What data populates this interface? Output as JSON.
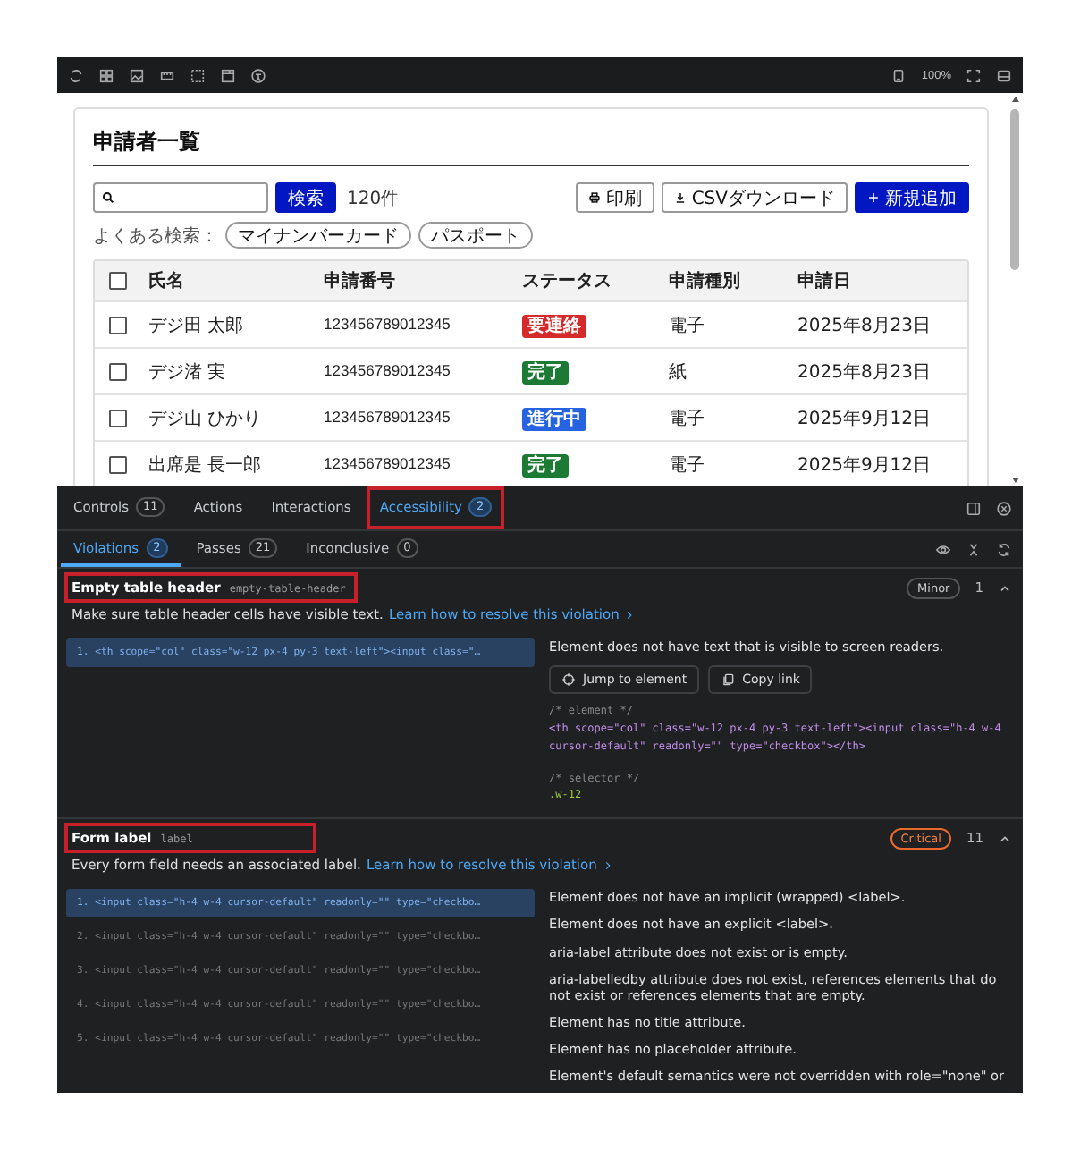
{
  "toolbar": {
    "zoom": "100%"
  },
  "page": {
    "title": "申請者一覧",
    "search_button": "検索",
    "result_count": "120件",
    "actions": [
      {
        "label": "印刷",
        "kind": "print"
      },
      {
        "label": "CSVダウンロード",
        "kind": "download"
      },
      {
        "label": "新規追加",
        "kind": "add"
      }
    ],
    "suggestions": {
      "label": "よくある検索：",
      "chips": [
        "マイナンバーカード",
        "パスポート"
      ]
    },
    "table": {
      "header_checked": false,
      "columns": [
        "氏名",
        "申請番号",
        "ステータス",
        "申請種別",
        "申請日"
      ],
      "rows": [
        {
          "checked": false,
          "name": "デジ田 太郎",
          "number": "123456789012345",
          "status": {
            "label": "要連絡",
            "color": "#d42a2a"
          },
          "type": "電子",
          "date": "2025年8月23日"
        },
        {
          "checked": false,
          "name": "デジ渚 実",
          "number": "123456789012345",
          "status": {
            "label": "完了",
            "color": "#1d7a35"
          },
          "type": "紙",
          "date": "2025年8月23日"
        },
        {
          "checked": false,
          "name": "デジ山 ひかり",
          "number": "123456789012345",
          "status": {
            "label": "進行中",
            "color": "#2563e0"
          },
          "type": "電子",
          "date": "2025年9月12日"
        },
        {
          "checked": false,
          "name": "出席是 長一郎",
          "number": "123456789012345",
          "status": {
            "label": "完了",
            "color": "#1d7a35"
          },
          "type": "電子",
          "date": "2025年9月12日"
        }
      ]
    }
  },
  "panel": {
    "tabs": [
      {
        "label": "Controls",
        "count": "11",
        "selected": false,
        "annotated": false
      },
      {
        "label": "Actions",
        "selected": false,
        "annotated": false
      },
      {
        "label": "Interactions",
        "selected": false,
        "annotated": false
      },
      {
        "label": "Accessibility",
        "count": "2",
        "selected": true,
        "annotated": true
      }
    ],
    "subtabs": [
      {
        "label": "Violations",
        "count": "2",
        "selected": true
      },
      {
        "label": "Passes",
        "count": "21",
        "selected": false
      },
      {
        "label": "Inconclusive",
        "count": "0",
        "selected": false
      }
    ],
    "violations": [
      {
        "title": "Empty table header",
        "id": "empty-table-header",
        "annotated": true,
        "impact": {
          "label": "Minor",
          "kind": "minor"
        },
        "count": "1",
        "expanded": true,
        "description": "Make sure table header cells have visible text.",
        "link": "Learn how to resolve this violation",
        "entries": [
          {
            "index": "1.",
            "code": "<th scope=\"col\" class=\"w-12 px-4 py-3 text-left\"><input class=\"…",
            "selected": true
          }
        ],
        "details": {
          "kind": "inspect",
          "message": "Element does not have text that is visible to screen readers.",
          "actions": [
            "Jump to element",
            "Copy link"
          ],
          "element_comment": "/* element */",
          "element_code": "<th scope=\"col\" class=\"w-12 px-4 py-3 text-left\"><input class=\"h-4 w-4 cursor-default\" readonly=\"\" type=\"checkbox\"></th>",
          "selector_comment": "/* selector */",
          "selector": ".w-12"
        }
      },
      {
        "title": "Form label",
        "id": "label",
        "annotated": true,
        "impact": {
          "label": "Critical",
          "kind": "critical"
        },
        "count": "11",
        "expanded": true,
        "description": "Every form field needs an associated label.",
        "link": "Learn how to resolve this violation",
        "entries": [
          {
            "index": "1.",
            "code": "<input class=\"h-4 w-4 cursor-default\" readonly=\"\" type=\"checkbo…",
            "selected": true
          },
          {
            "index": "2.",
            "code": "<input class=\"h-4 w-4 cursor-default\" readonly=\"\" type=\"checkbo…",
            "selected": false
          },
          {
            "index": "3.",
            "code": "<input class=\"h-4 w-4 cursor-default\" readonly=\"\" type=\"checkbo…",
            "selected": false
          },
          {
            "index": "4.",
            "code": "<input class=\"h-4 w-4 cursor-default\" readonly=\"\" type=\"checkbo…",
            "selected": false
          },
          {
            "index": "5.",
            "code": "<input class=\"h-4 w-4 cursor-default\" readonly=\"\" type=\"checkbo…",
            "selected": false
          }
        ],
        "details": {
          "kind": "checks",
          "messages": [
            "Element does not have an implicit (wrapped) <label>.",
            "Element does not have an explicit <label>.",
            "aria-label attribute does not exist or is empty.",
            "aria-labelledby attribute does not exist, references elements that do not exist or references elements that are empty.",
            "Element has no title attribute.",
            "Element has no placeholder attribute.",
            "Element's default semantics were not overridden with role=\"none\" or"
          ]
        }
      }
    ]
  }
}
